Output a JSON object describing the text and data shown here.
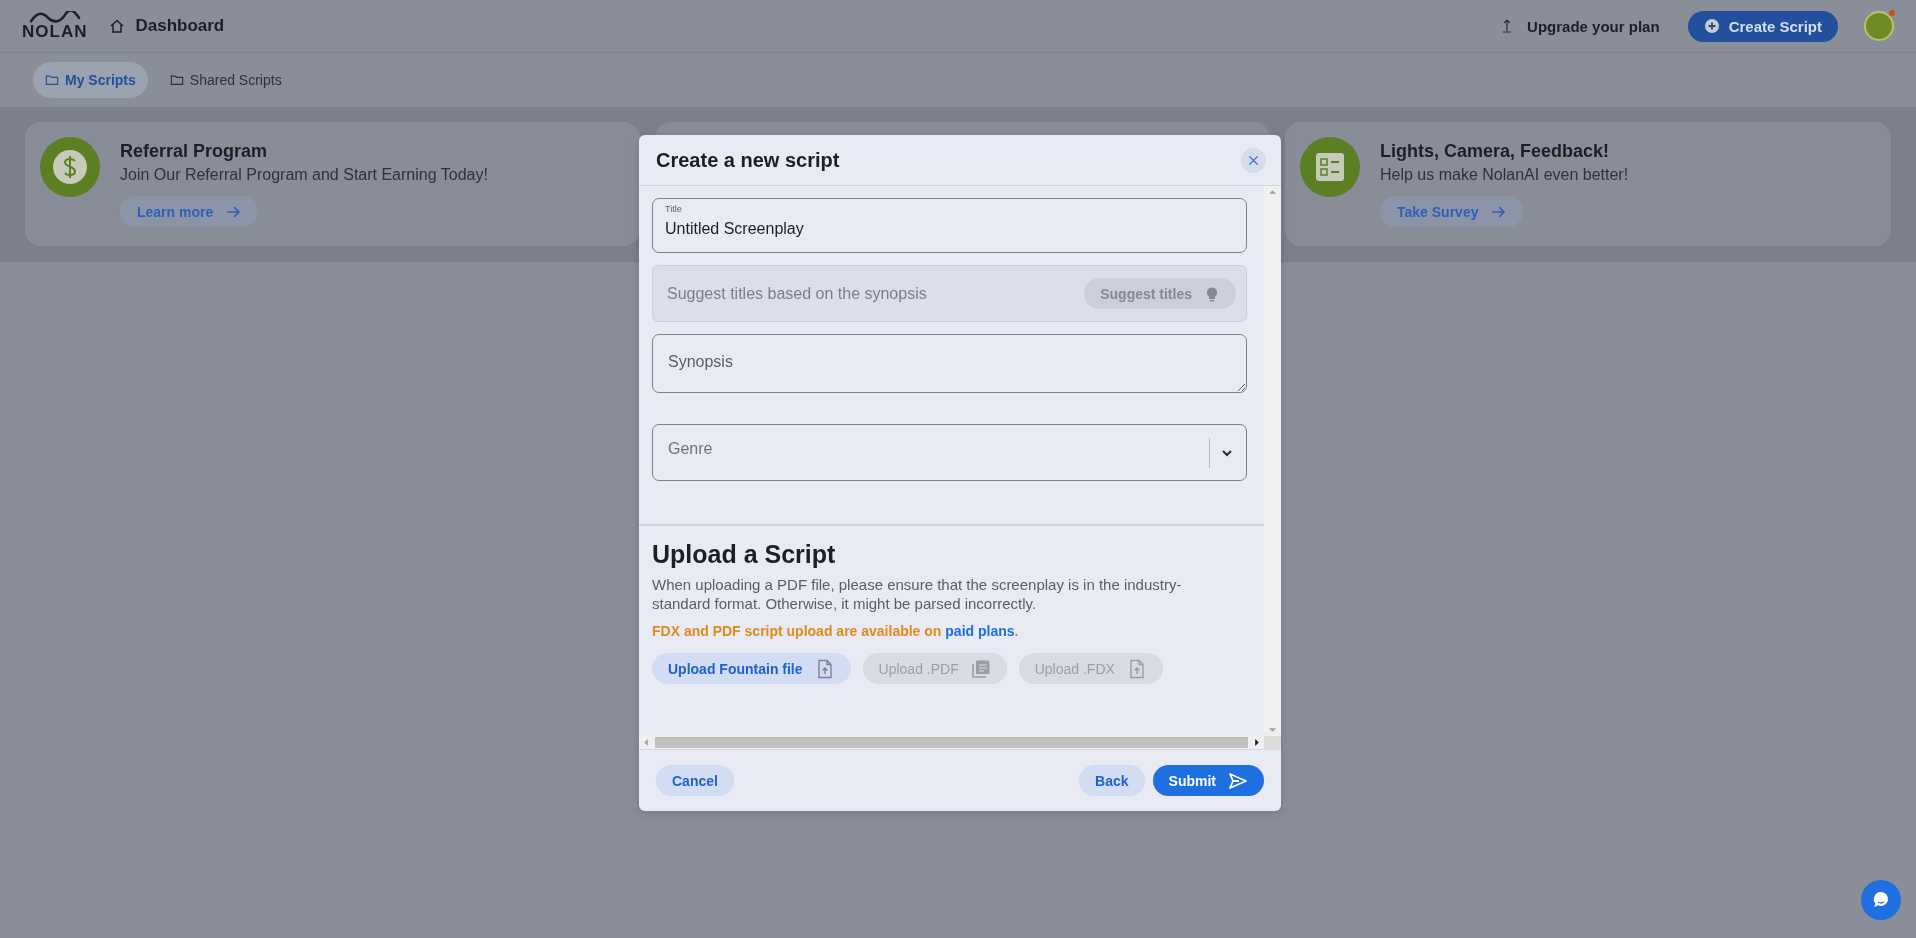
{
  "header": {
    "logo": "NOLAN",
    "title": "Dashboard",
    "upgrade": "Upgrade your plan",
    "create_button": "Create Script"
  },
  "tabs": [
    {
      "label": "My Scripts",
      "selected": true
    },
    {
      "label": "Shared Scripts",
      "selected": false
    }
  ],
  "banners": [
    {
      "kind": "referral",
      "title": "Referral Program",
      "subtitle": "Join Our Referral Program and Start Earning Today!",
      "action": "Learn more"
    },
    {
      "kind": "covered"
    },
    {
      "kind": "survey",
      "title": "Lights, Camera, Feedback!",
      "subtitle": "Help us make NolanAI even better!",
      "action": "Take Survey"
    }
  ],
  "modal": {
    "title": "Create a new script",
    "title_field": {
      "label": "Title",
      "value": "Untitled Screenplay"
    },
    "suggest": {
      "placeholder": "Suggest titles based on the synopsis",
      "button": "Suggest titles",
      "disabled": true
    },
    "synopsis": {
      "placeholder": "Synopsis"
    },
    "genre": {
      "placeholder": "Genre"
    },
    "upload": {
      "heading": "Upload a Script",
      "description": "When uploading a PDF file, please ensure that the screenplay is in the industry-standard format. Otherwise, it might be parsed incorrectly.",
      "notice": "FDX and PDF script upload are available on ",
      "notice_link": "paid plans",
      "notice_end": ".",
      "buttons": [
        {
          "kind": "fountain",
          "label": "Upload Fountain file",
          "disabled": false
        },
        {
          "kind": "pdf",
          "label": "Upload .PDF",
          "disabled": true
        },
        {
          "kind": "fdx",
          "label": "Upload .FDX",
          "disabled": true
        }
      ]
    },
    "footer": {
      "cancel": "Cancel",
      "back": "Back",
      "submit": "Submit"
    }
  }
}
